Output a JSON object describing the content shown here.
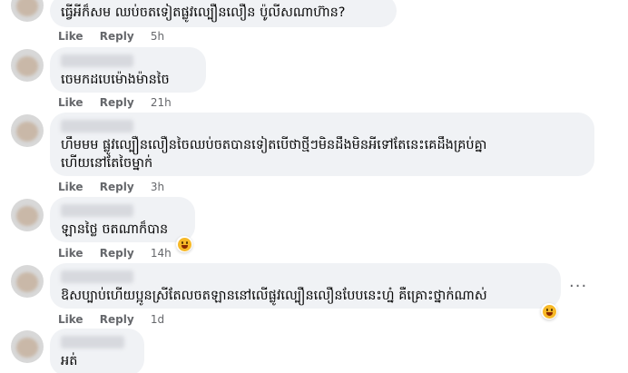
{
  "comments": [
    {
      "author": "",
      "text": "ធ្វើអីក៏សម ឈប់ចតទៀតផ្លូវល្បឿនលឿន ប៉ូលីសណាហ៊ាន?",
      "like": "Like",
      "reply": "Reply",
      "time": "5h"
    },
    {
      "author": "",
      "text": "ចេមកដបេម៉ោងម៉ានចៃ",
      "like": "Like",
      "reply": "Reply",
      "time": "21h"
    },
    {
      "author": "",
      "text_line1": "ហឹមមម ផ្លូវល្បឿនលឿនចៃឈប់ចតបានទៀតបើថាថ្មីៗមិនដឹងមិនអីទៅតែនេះគេដឹងគ្រប់គ្នា",
      "text_line2": "ហើយនៅតែចៃម្នាក់",
      "like": "Like",
      "reply": "Reply",
      "time": "3h"
    },
    {
      "author": "",
      "text": "ឡានថ្លៃ ចតណាក៏បាន",
      "like": "Like",
      "reply": "Reply",
      "time": "14h"
    },
    {
      "author": "",
      "text": "ឱសប្បាប់ហើយប្អូនស្រីតែលចតឡាននៅលើផ្លូវល្បឿនលឿនបែបនេះហ្ន៎ គឺគ្រោះថ្នាក់ណាស់",
      "like": "Like",
      "reply": "Reply",
      "time": "1d",
      "more": "···"
    },
    {
      "author": "",
      "text": "អត់"
    }
  ],
  "reaction_icon": "haha-emoji-icon",
  "colors": {
    "bubble": "#f0f2f5",
    "meta": "#65676b",
    "text": "#050505",
    "reaction": "#f7b928"
  }
}
